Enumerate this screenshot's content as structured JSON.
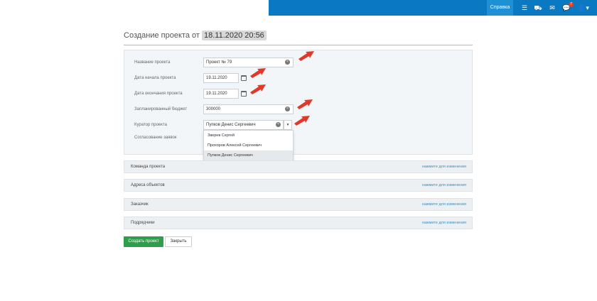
{
  "topbar": {
    "help_label": "Справка",
    "icons": [
      "list-icon",
      "cart-icon",
      "envelope-icon",
      "chat-icon",
      "user-icon"
    ],
    "chat_badge": "7",
    "accent": "#0b79c2"
  },
  "header": {
    "title_prefix": "Создание проекта от",
    "title_date": "18.11.2020 20:56"
  },
  "form": {
    "name_label": "Название проекта",
    "name_value": "Проект № 79",
    "start_label": "Дата начала проекта",
    "start_value": "19.11.2020",
    "end_label": "Дата окончания проекта",
    "end_value": "19.11.2020",
    "budget_label": "Запланированный бюджет",
    "budget_value": "300000",
    "curator_label": "Куратор проекта",
    "curator_value": "Пупков Денис Сергеевич",
    "approval_label": "Согласование заявок"
  },
  "dropdown": {
    "options": [
      "Зверев Сергей",
      "Прохоров Алексей Сергеевич",
      "Пупков Денис Сергеевич"
    ],
    "selected_index": 2
  },
  "sections": [
    {
      "title": "Команда проекта",
      "link": "нажмите для изменения"
    },
    {
      "title": "Адреса объектов",
      "link": "нажмите для изменения"
    },
    {
      "title": "Заказчик",
      "link": "нажмите для изменения"
    },
    {
      "title": "Подрядчики",
      "link": "нажмите для изменения"
    }
  ],
  "buttons": {
    "create": "Создать проект",
    "close": "Закрыть"
  }
}
